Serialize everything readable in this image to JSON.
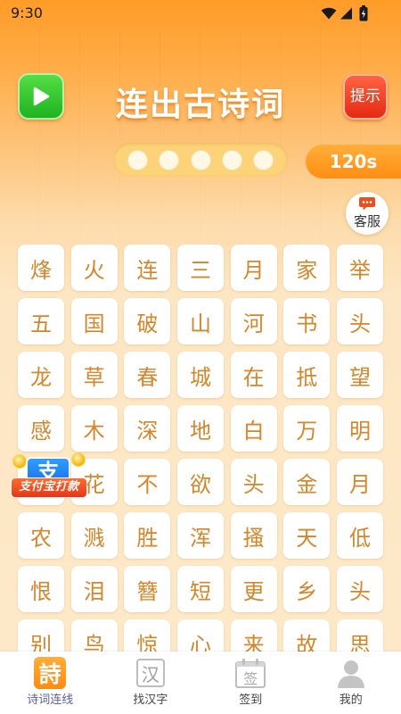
{
  "status_bar": {
    "time": "9:30",
    "icons": [
      "wifi-icon",
      "signal-icon",
      "battery-icon"
    ]
  },
  "header": {
    "play_icon": "play-icon",
    "title": "连出古诗词",
    "hint_label": "提示"
  },
  "progress": {
    "total": 5,
    "filled": 0
  },
  "timer": {
    "label": "120s"
  },
  "service": {
    "icon": "chat-icon",
    "label": "客服"
  },
  "grid": {
    "rows": [
      [
        "烽",
        "火",
        "连",
        "三",
        "月",
        "家",
        "举"
      ],
      [
        "五",
        "国",
        "破",
        "山",
        "河",
        "书",
        "头"
      ],
      [
        "龙",
        "草",
        "春",
        "城",
        "在",
        "抵",
        "望"
      ],
      [
        "感",
        "木",
        "深",
        "地",
        "白",
        "万",
        "明"
      ],
      [
        "",
        "花",
        "不",
        "欲",
        "头",
        "金",
        "月"
      ],
      [
        "农",
        "溅",
        "胜",
        "浑",
        "搔",
        "天",
        "低"
      ],
      [
        "恨",
        "泪",
        "簪",
        "短",
        "更",
        "乡",
        "头"
      ],
      [
        "别",
        "鸟",
        "惊",
        "心",
        "来",
        "故",
        "思"
      ]
    ]
  },
  "promo": {
    "logo": "支",
    "label": "支付宝打款"
  },
  "nav": {
    "items": [
      {
        "label": "诗词连线",
        "icon": "poem-icon",
        "glyph": "詩",
        "active": true
      },
      {
        "label": "找汉字",
        "icon": "find-character-icon",
        "glyph": "汉",
        "active": false
      },
      {
        "label": "签到",
        "icon": "calendar-icon",
        "glyph": "签",
        "active": false
      },
      {
        "label": "我的",
        "icon": "person-icon",
        "active": false
      }
    ]
  },
  "colors": {
    "accent": "#ff9a1a",
    "play_button": "#2cc22a",
    "hint_button": "#f03a1e",
    "cell_text": "#d5852a",
    "timer": "#ff9419",
    "active_tab": "#5d5da5"
  }
}
